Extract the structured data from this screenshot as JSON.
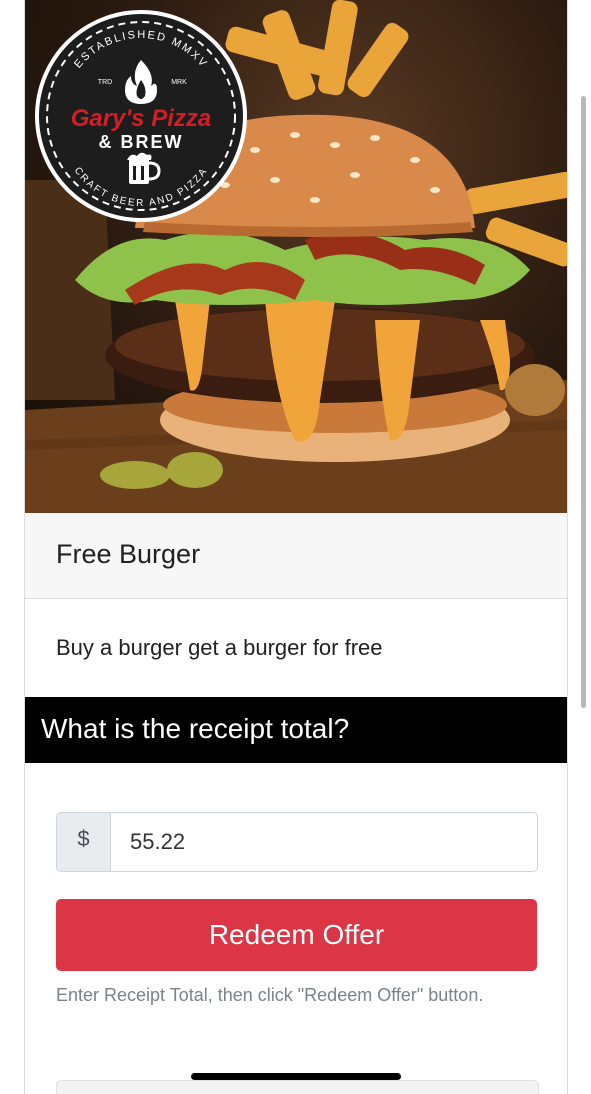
{
  "logo": {
    "arc_top": "ESTABLISHED MMXV",
    "left_mark": "TRD",
    "right_mark": "MRK",
    "brand": "Gary's Pizza",
    "brand_sub": "& BREW",
    "arc_bottom": "CRAFT BEER AND PIZZA"
  },
  "offer": {
    "title": "Free Burger",
    "description": "Buy a burger get a burger for free"
  },
  "form": {
    "question": "What is the receipt total?",
    "currency_symbol": "$",
    "amount_value": "55.22",
    "redeem_label": "Redeem Offer",
    "help_text": "Enter Receipt Total, then click \"Redeem Offer\" button."
  },
  "colors": {
    "accent": "#dc3545",
    "brand_red": "#d21f26",
    "header_black": "#000000"
  }
}
